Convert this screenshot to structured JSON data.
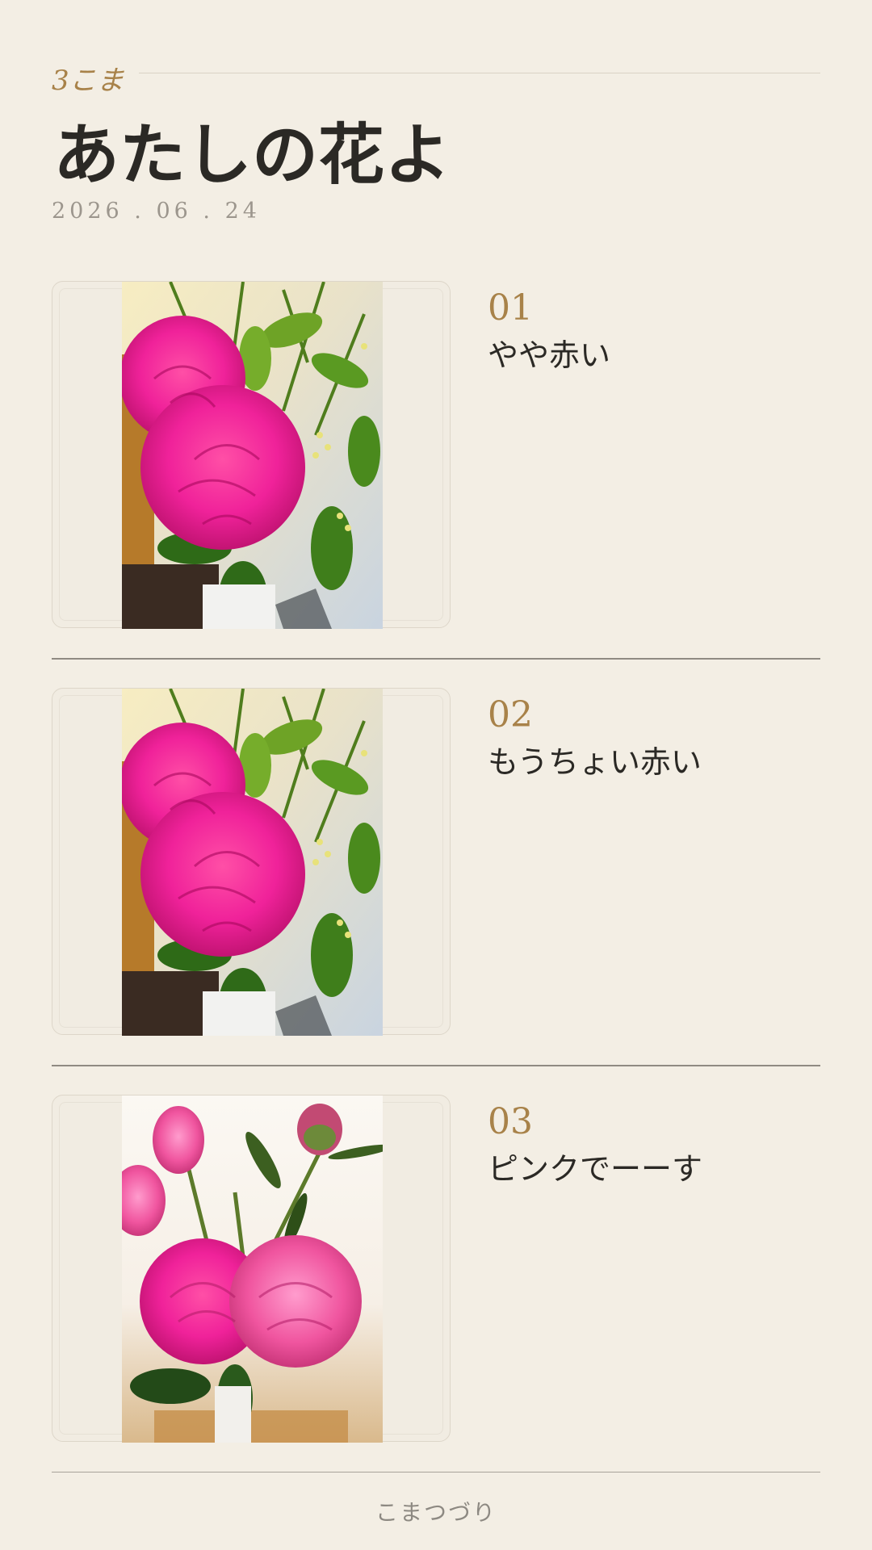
{
  "header": {
    "koma_count": "3こま",
    "title": "あたしの花よ",
    "date": "2026 . 06 . 24"
  },
  "entries": [
    {
      "number": "01",
      "caption": "やや赤い",
      "photo": "peony-bouquet-vivid"
    },
    {
      "number": "02",
      "caption": "もうちょい赤い",
      "photo": "peony-bouquet-vivid"
    },
    {
      "number": "03",
      "caption": "ピンクでーーす",
      "photo": "peony-bouquet-pink"
    }
  ],
  "footer": {
    "brand": "こまつづり"
  },
  "colors": {
    "background": "#f3eee4",
    "accent": "#a88249",
    "text": "#2b2925",
    "muted": "#9c968d"
  }
}
